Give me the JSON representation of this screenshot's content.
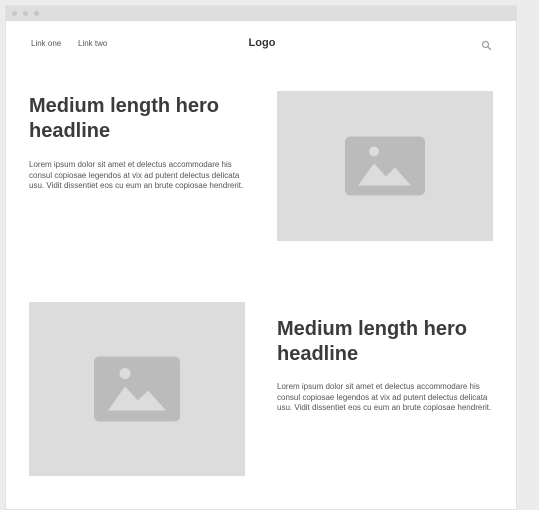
{
  "nav": {
    "links": [
      "Link one",
      "Link two"
    ],
    "logo": "Logo",
    "search_icon": "search-icon"
  },
  "sections": [
    {
      "headline": "Medium length hero headline",
      "body": "Lorem ipsum dolor sit amet et delectus accommodare his consul copiosae legendos at vix ad putent delectus delicata usu. Vidit dissentiet eos cu eum an brute copiosae hendrerit.",
      "image_icon": "image-placeholder-icon"
    },
    {
      "headline": "Medium length hero headline",
      "body": "Lorem ipsum dolor sit amet et delectus accommodare his consul copiosae legendos at vix ad putent delectus delicata usu. Vidit dissentiet eos cu eum an brute copiosae hendrerit.",
      "image_icon": "image-placeholder-icon"
    }
  ],
  "colors": {
    "page_background": "#ececec",
    "placeholder_fill": "#dcdcdc",
    "placeholder_icon": "#bbbbbb",
    "headline_text": "#3b3b3b"
  }
}
